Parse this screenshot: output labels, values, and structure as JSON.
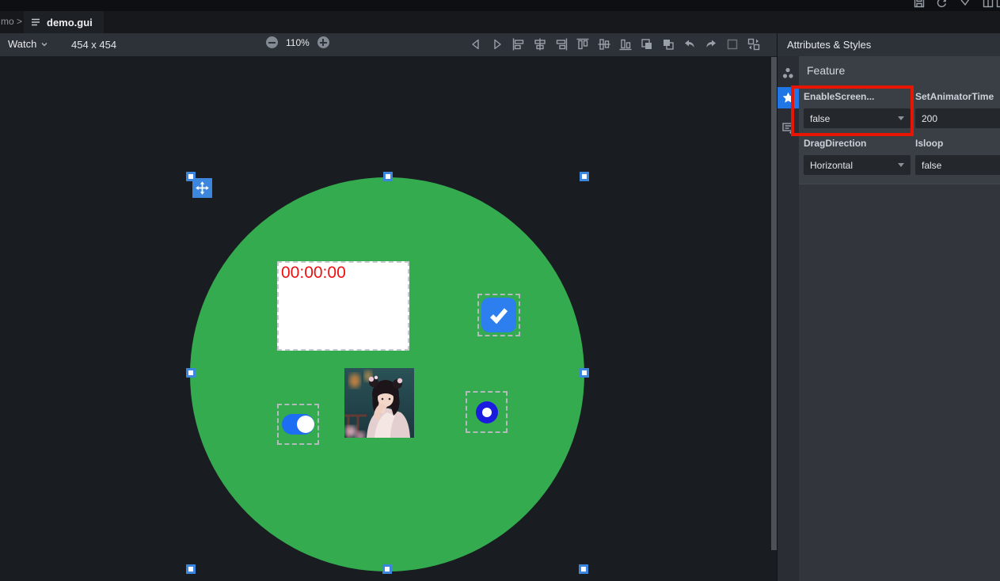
{
  "colors": {
    "circle_green": "#35ab4f",
    "selection_blue": "#3c87dd",
    "checkbox_blue": "#2d7ff0",
    "toggle_blue": "#1d6ef2",
    "radio_blue": "#1b1be0",
    "clock_text_red": "#ee1111",
    "annotation_red": "#e81505",
    "panel_selected_blue": "#1f76e4"
  },
  "titlebar": {
    "icons": [
      "save-icon",
      "sync-icon",
      "check-icon",
      "layout-columns-icon",
      "panel-right-icon"
    ]
  },
  "tabbar": {
    "breadcrumb": "mo >",
    "tab_label": "demo.gui"
  },
  "toolbar": {
    "device_selector_label": "Watch",
    "canvas_size": "454 x 454",
    "zoom_level": "110%",
    "icons": [
      "step-back-icon",
      "step-forward-icon",
      "align-left-icon",
      "align-horizontal-center-icon",
      "align-right-icon",
      "align-top-icon",
      "align-vertical-center-icon",
      "align-bottom-icon",
      "bring-to-front-icon",
      "send-to-back-icon",
      "undo-icon",
      "redo-icon",
      "marquee-icon",
      "replace-widget-icon"
    ]
  },
  "canvas": {
    "clock_text": "00:00:00"
  },
  "panel": {
    "title": "Attributes & Styles",
    "section_title": "Feature",
    "tool_icons": [
      "hierarchy-icon",
      "plugin-icon",
      "form-edit-icon"
    ],
    "fields": [
      {
        "label": "EnableScreen...",
        "value": "false",
        "control": "dropdown"
      },
      {
        "label": "SetAnimatorTime",
        "value": "200",
        "control": "input"
      },
      {
        "label": "DragDirection",
        "value": "Horizontal",
        "control": "dropdown"
      },
      {
        "label": "Isloop",
        "value": "false",
        "control": "input"
      }
    ]
  }
}
